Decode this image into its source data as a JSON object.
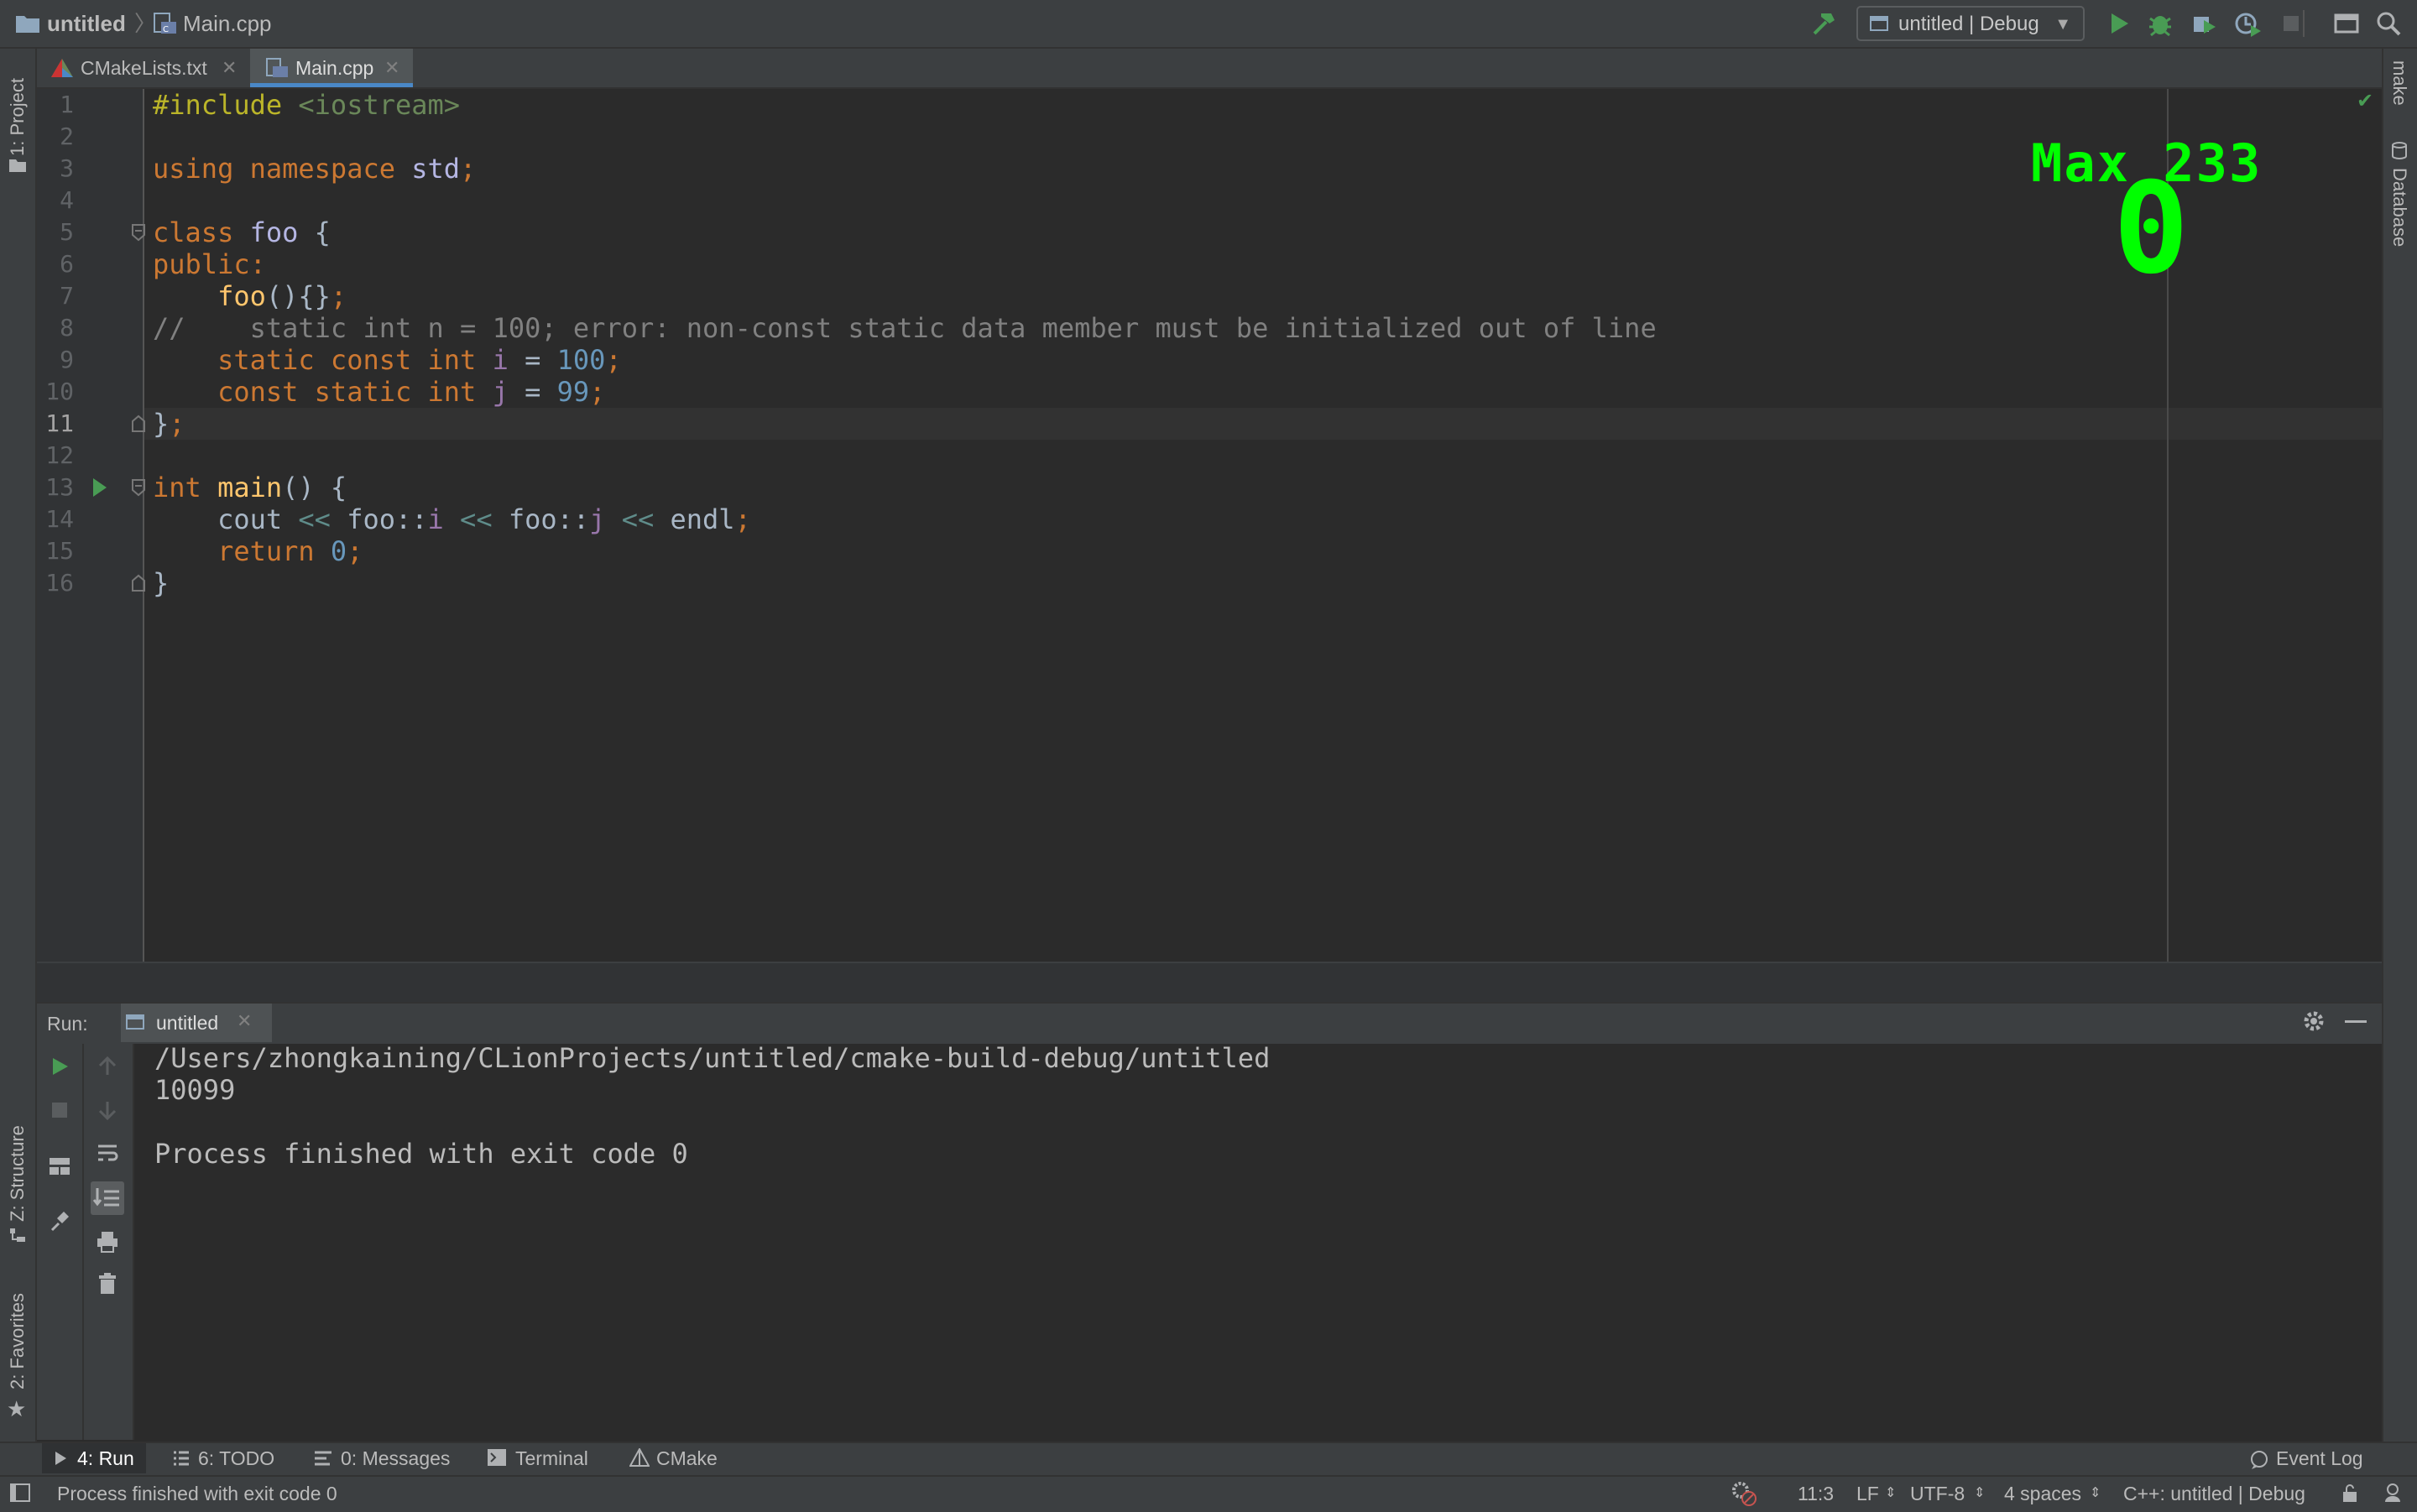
{
  "breadcrumb": {
    "project": "untitled",
    "file": "Main.cpp"
  },
  "toolbar": {
    "run_config": "untitled | Debug"
  },
  "tabs": [
    {
      "label": "CMakeLists.txt",
      "active": false
    },
    {
      "label": "Main.cpp",
      "active": true
    }
  ],
  "left_tool_windows": {
    "project": "1: Project",
    "structure": "Z: Structure",
    "favorites": "2: Favorites"
  },
  "right_tool_windows": {
    "make": "make",
    "database": "Database"
  },
  "editor": {
    "line_numbers": [
      "1",
      "2",
      "3",
      "4",
      "5",
      "6",
      "7",
      "8",
      "9",
      "10",
      "11",
      "12",
      "13",
      "14",
      "15",
      "16"
    ],
    "current_line": "11"
  },
  "code": {
    "l1_a": "#include",
    "l1_b": " <iostream>",
    "l3_a": "using namespace",
    "l3_b": " std",
    "l3_c": ";",
    "l5_a": "class",
    "l5_b": " foo",
    "l5_c": " {",
    "l6": "public:",
    "l7_a": "    foo",
    "l7_b": "(){}",
    "l7_c": ";",
    "l8": "//    static int n = 100; error: non-const static data member must be initialized out of line",
    "l9_a": "    static const int",
    "l9_b": " i",
    "l9_c": " = ",
    "l9_d": "100",
    "l9_e": ";",
    "l10_a": "    const static int",
    "l10_b": " j",
    "l10_c": " = ",
    "l10_d": "99",
    "l10_e": ";",
    "l11_a": "}",
    "l11_b": ";",
    "l13_a": "int",
    "l13_b": " main",
    "l13_c": "() {",
    "l14_a": "    cout ",
    "l14_b": "<<",
    "l14_c": " foo::",
    "l14_d": "i",
    "l14_e": " ",
    "l14_f": "<<",
    "l14_g": " foo::",
    "l14_h": "j",
    "l14_i": " ",
    "l14_j": "<<",
    "l14_k": " endl",
    "l14_l": ";",
    "l15_a": "    return",
    "l15_b": " 0",
    "l15_c": ";",
    "l16": "}"
  },
  "overlay": {
    "title": "Max 233",
    "value": "0"
  },
  "run_panel": {
    "label": "Run:",
    "tab": "untitled",
    "output": [
      "/Users/zhongkaining/CLionProjects/untitled/cmake-build-debug/untitled",
      "10099",
      "",
      "Process finished with exit code 0"
    ]
  },
  "bottom_tabs": {
    "run": "4: Run",
    "todo": "6: TODO",
    "messages": "0: Messages",
    "terminal": "Terminal",
    "cmake": "CMake",
    "event_log": "Event Log"
  },
  "status": {
    "message": "Process finished with exit code 0",
    "position": "11:3",
    "line_sep": "LF",
    "encoding": "UTF-8",
    "indent": "4 spaces",
    "context": "C++: untitled | Debug"
  },
  "colors": {
    "accent": "#4a88c7",
    "run_green": "#499c54",
    "overlay_green": "#00ff00"
  }
}
